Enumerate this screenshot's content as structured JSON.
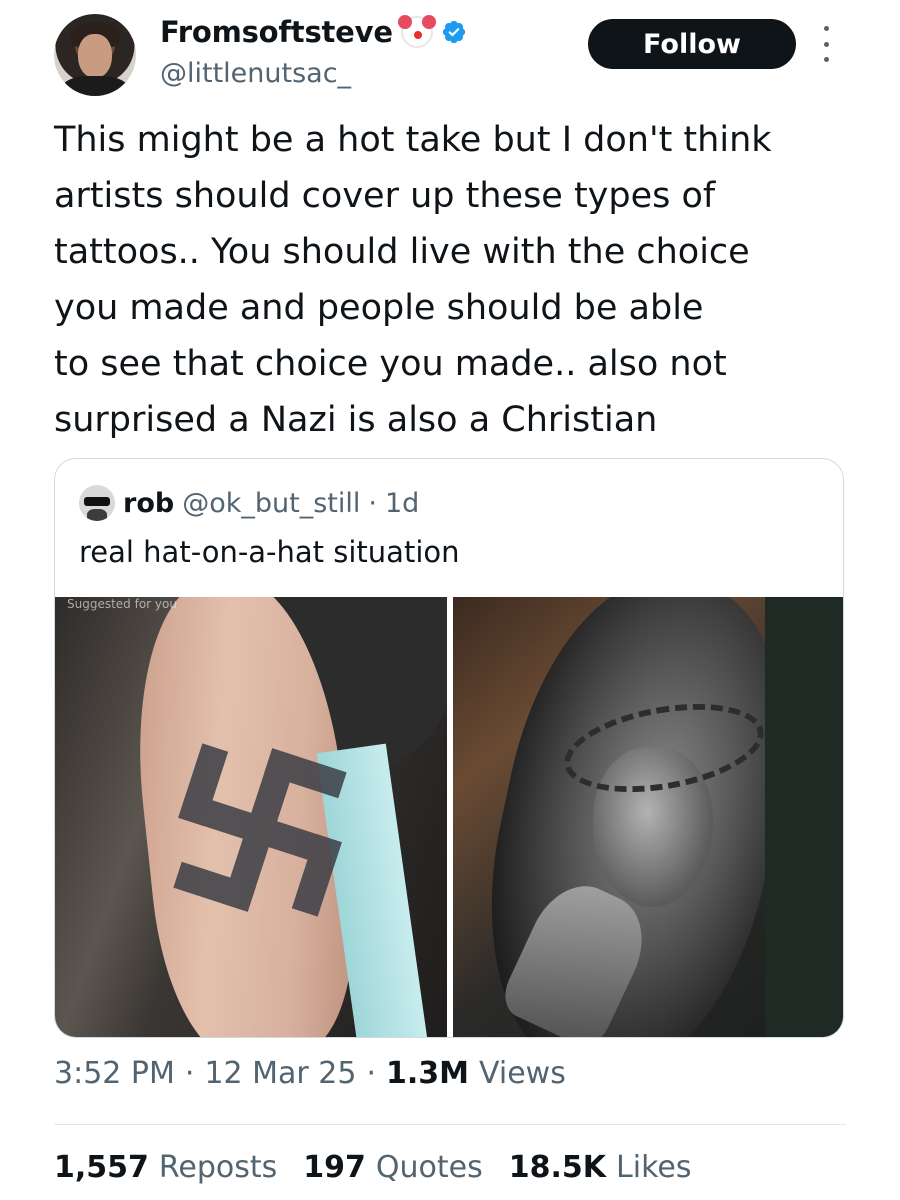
{
  "author": {
    "display_name": "Fromsoftsteve",
    "handle": "@littlenutsac_",
    "badges": [
      "clown-emoji",
      "verified-badge"
    ]
  },
  "actions": {
    "follow_label": "Follow",
    "more_icon": "more-vertical-icon"
  },
  "tweet": {
    "text": "This might be a hot take but I don't think\nartists should cover up these types of\ntattoos.. You should live with the choice\nyou made and people should be able\nto see that choice you made.. also not\nsurprised a Nazi is also a Christian"
  },
  "quote": {
    "name": "rob",
    "handle": "@ok_but_still",
    "separator": "·",
    "time": "1d",
    "text": "real hat-on-a-hat situation",
    "media_caption": "Suggested for you"
  },
  "meta": {
    "time": "3:52 PM",
    "separator": "·",
    "date": "12 Mar 25",
    "views_count": "1.3M",
    "views_label": "Views"
  },
  "stats": {
    "reposts_count": "1,557",
    "reposts_label": "Reposts",
    "quotes_count": "197",
    "quotes_label": "Quotes",
    "likes_count": "18.5K",
    "likes_label": "Likes"
  },
  "colors": {
    "text": "#0f1419",
    "muted": "#536471",
    "verified": "#1d9bf0",
    "border": "#cfd9de"
  }
}
